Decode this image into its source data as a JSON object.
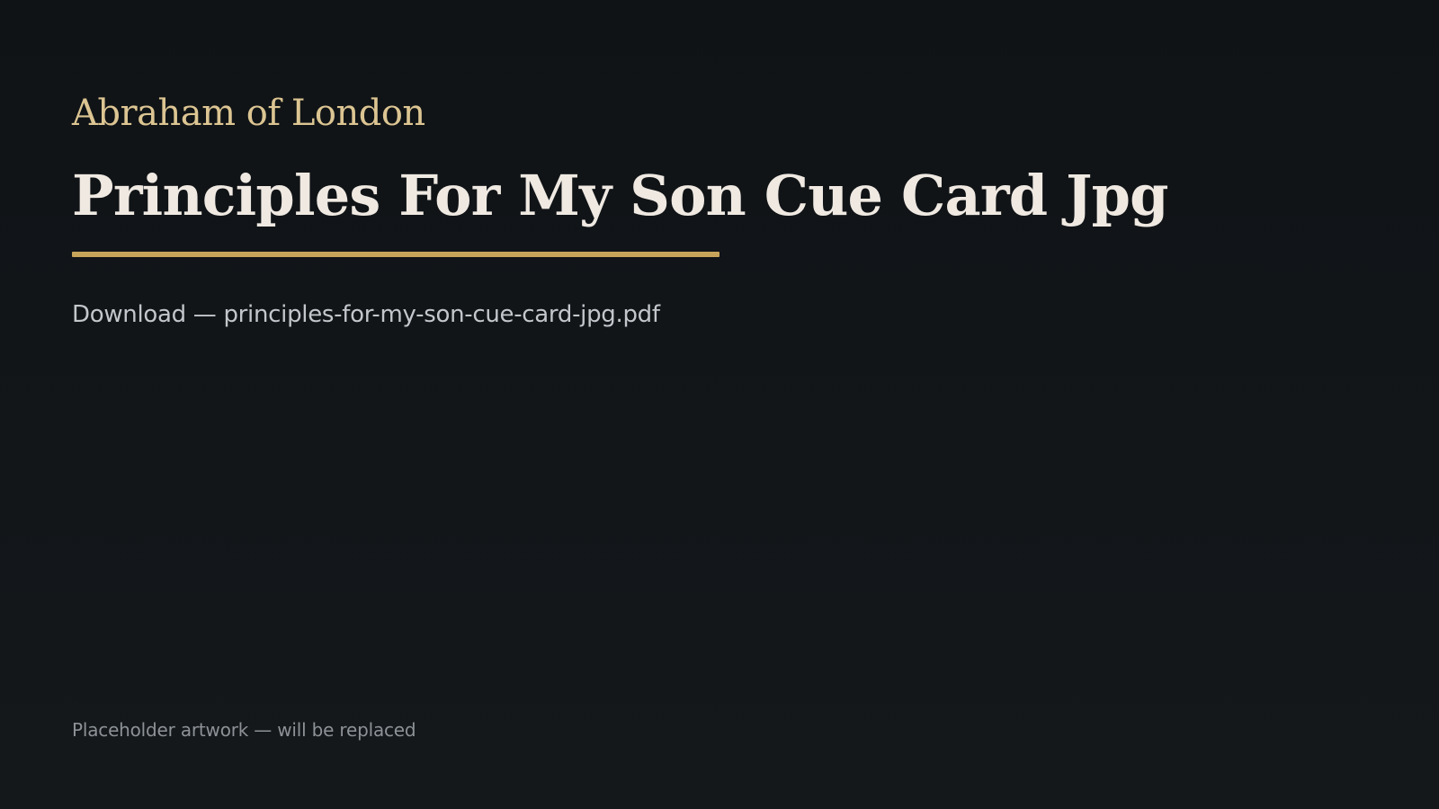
{
  "brand": "Abraham of London",
  "title": "Principles For My Son Cue Card Jpg",
  "download_text": "Download — principles-for-my-son-cue-card-jpg.pdf",
  "footnote": "Placeholder artwork — will be replaced",
  "colors": {
    "background": "#111417",
    "brand": "#dcc592",
    "title": "#efe9e2",
    "accent_rule": "#c8a45a",
    "body_text": "#c3c7cb",
    "muted_text": "#8d9297"
  }
}
